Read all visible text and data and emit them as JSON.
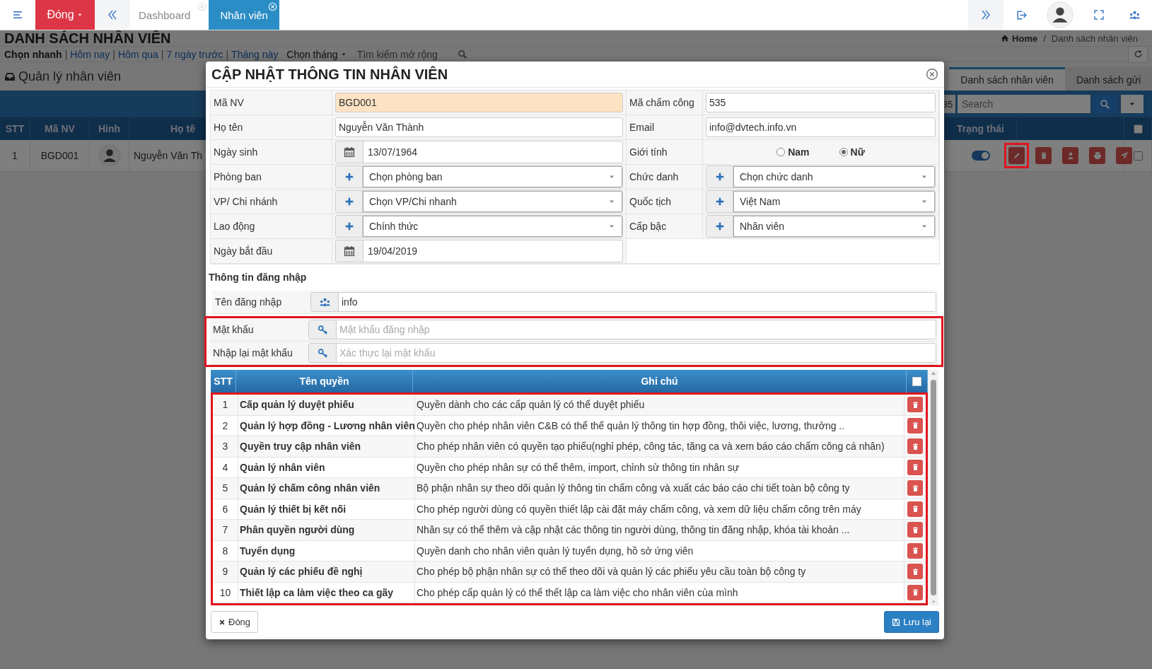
{
  "topbar": {
    "close_button": "Đóng",
    "tabs": [
      {
        "label": "Dashboard",
        "selected": false
      },
      {
        "label": "Nhân viên",
        "selected": true
      }
    ]
  },
  "page": {
    "title": "DANH SÁCH NHÂN VIÊN",
    "breadcrumb": {
      "home": "Home",
      "separator": "/",
      "current": "Danh sách nhân viên"
    },
    "quick_filter": {
      "label": "Chọn nhanh",
      "separator": "|",
      "links": [
        "Hôm nay",
        "Hôm qua",
        "7 ngày trước",
        "Tháng này"
      ],
      "month_select": "Chọn tháng",
      "advanced_search": "Tìm kiếm mở rộng"
    },
    "panel": {
      "title": "Quản lý nhân viên",
      "tabs": [
        {
          "label": "Danh sách nhân viên",
          "selected": true
        },
        {
          "label": "Danh sách gửi",
          "selected": false
        }
      ],
      "page_count": "35",
      "search": {
        "placeholder": "Search"
      },
      "table": {
        "columns": [
          "STT",
          "Mã NV",
          "Hình",
          "Họ tê",
          "Trạng thái"
        ],
        "select_all": false,
        "rows": [
          {
            "stt": "1",
            "code": "BGD001",
            "name": "Nguyễn Văn Th",
            "on": true,
            "checked": false,
            "actions": [
              {
                "kind": "edit",
                "highlighted": true
              },
              {
                "kind": "delete",
                "highlighted": false
              },
              {
                "kind": "user",
                "highlighted": false
              },
              {
                "kind": "print",
                "highlighted": false
              },
              {
                "kind": "send",
                "highlighted": false
              }
            ]
          }
        ]
      }
    }
  },
  "modal": {
    "title": "CẬP NHẬT THÔNG TIN NHÂN VIÊN",
    "form": [
      {
        "cells": [
          {
            "label": "Mã NV",
            "kind": "text",
            "value": "BGD001",
            "readonly": true
          },
          {
            "label": "Mã chấm công",
            "kind": "text",
            "value": "535",
            "readonly": false
          }
        ]
      },
      {
        "cells": [
          {
            "label": "Họ tên",
            "kind": "text",
            "value": "Nguyễn Văn Thành",
            "readonly": false
          },
          {
            "label": "Email",
            "kind": "text",
            "value": "info@dvtech.info.vn",
            "readonly": false
          }
        ]
      },
      {
        "cells": [
          {
            "label": "Ngày sinh",
            "kind": "date",
            "value": "13/07/1964"
          },
          {
            "label": "Giới tính",
            "kind": "radio",
            "options": [
              {
                "label": "Nam",
                "selected": false
              },
              {
                "label": "Nữ",
                "selected": true
              }
            ]
          }
        ]
      },
      {
        "cells": [
          {
            "label": "Phòng ban",
            "kind": "select",
            "value": "Chọn phòng ban"
          },
          {
            "label": "Chức danh",
            "kind": "select",
            "value": "Chọn chức danh"
          }
        ]
      },
      {
        "cells": [
          {
            "label": "VP/ Chi nhánh",
            "kind": "select",
            "value": "Chọn VP/Chi nhanh"
          },
          {
            "label": "Quốc tịch",
            "kind": "select",
            "value": "Việt Nam"
          }
        ]
      },
      {
        "cells": [
          {
            "label": "Lao động",
            "kind": "select",
            "value": "Chính thức"
          },
          {
            "label": "Cấp bậc",
            "kind": "select",
            "value": "Nhân viên"
          }
        ]
      },
      {
        "cells": [
          {
            "label": "Ngày bắt đầu",
            "kind": "date",
            "value": "19/04/2019"
          }
        ]
      }
    ],
    "login": {
      "title": "Thông tin đăng nhập",
      "rows": [
        {
          "label": "Tên đăng nhập",
          "kind": "account",
          "value": "info",
          "highlighted": false
        },
        {
          "label": "Mật khẩu",
          "kind": "password",
          "placeholder": "Mật khẩu đăng nhập",
          "highlighted": true
        },
        {
          "label": "Nhập lại mật khẩu",
          "kind": "password",
          "placeholder": "Xác thực lại mật khẩu",
          "highlighted": true
        }
      ]
    },
    "permissions": {
      "columns": [
        "STT",
        "Tên quyền",
        "Ghi chú"
      ],
      "select_all": false,
      "highlighted": true,
      "rows": [
        {
          "stt": "1",
          "name": "Cấp quản lý duyệt phiếu",
          "note": "Quyền dành cho các cấp quản lý có thể duyệt phiếu"
        },
        {
          "stt": "2",
          "name": "Quản lý hợp đồng - Lương nhân viên",
          "note": "Quyền cho phép nhân viên C&B có thể thể quản lý thông tin hợp đồng, thôi việc, lương, thưởng .."
        },
        {
          "stt": "3",
          "name": "Quyền truy cập nhân viên",
          "note": "Cho phép nhân viên có quyền tạo phiếu(nghỉ phép, công tác, tăng ca và xem báo cáo chấm công cá nhân)"
        },
        {
          "stt": "4",
          "name": "Quản lý nhân viên",
          "note": "Quyền cho phép nhân sự có thể thêm, import, chỉnh sử thông tin nhân sự"
        },
        {
          "stt": "5",
          "name": "Quản lý chấm công nhân viên",
          "note": "Bộ phận nhân sự theo dõi quản lý thông tin chấm công và xuất các báo cáo chi tiết toàn bộ công ty"
        },
        {
          "stt": "6",
          "name": "Quản lý thiết bị kết nối",
          "note": "Cho phép người dùng có quyền thiết lập cài đặt máy chấm công, và xem dữ liệu chấm công trên máy"
        },
        {
          "stt": "7",
          "name": "Phân quyền người dùng",
          "note": "Nhân sự có thể thêm và cập nhật các thông tin người dùng, thông tin đăng nhập, khóa tài khoản ..."
        },
        {
          "stt": "8",
          "name": "Tuyển dụng",
          "note": "Quyền danh cho nhân viên quản lý tuyển dụng, hồ sở ứng viên"
        },
        {
          "stt": "9",
          "name": "Quản lý các phiếu đề nghị",
          "note": "Cho phép bộ phận nhân sự có thể theo dõi và quản lý các phiếu yêu cầu toàn bộ công ty"
        },
        {
          "stt": "10",
          "name": "Thiết lập ca làm việc theo ca gãy",
          "note": "Cho phép cấp quản lý có thể thết lập ca làm việc cho nhân viên của mình"
        }
      ]
    },
    "buttons": [
      {
        "label": "Đóng",
        "kind": "close"
      },
      {
        "label": "Lưu lại",
        "kind": "save"
      }
    ]
  }
}
